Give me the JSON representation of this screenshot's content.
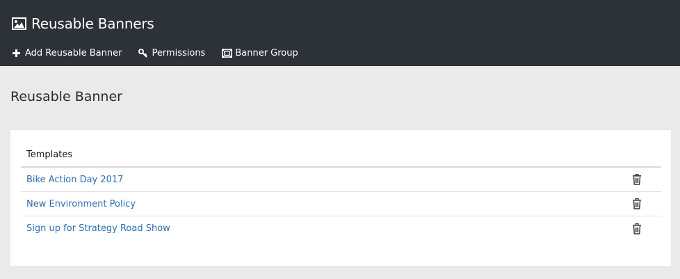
{
  "header": {
    "title": "Reusable Banners",
    "icon": "image-icon",
    "background": "#2d3138",
    "toolbar": [
      {
        "label": "Add Reusable Banner",
        "icon": "plus-icon"
      },
      {
        "label": "Permissions",
        "icon": "key-icon"
      },
      {
        "label": "Banner Group",
        "icon": "group-icon"
      }
    ]
  },
  "main": {
    "heading": "Reusable Banner",
    "table": {
      "column_header": "Templates",
      "rows": [
        {
          "name": "Bike Action Day 2017",
          "action_icon": "trash-icon"
        },
        {
          "name": "New Environment Policy",
          "action_icon": "trash-icon"
        },
        {
          "name": "Sign up for Strategy Road Show",
          "action_icon": "trash-icon"
        }
      ]
    },
    "link_color": "#2a6fb0"
  }
}
